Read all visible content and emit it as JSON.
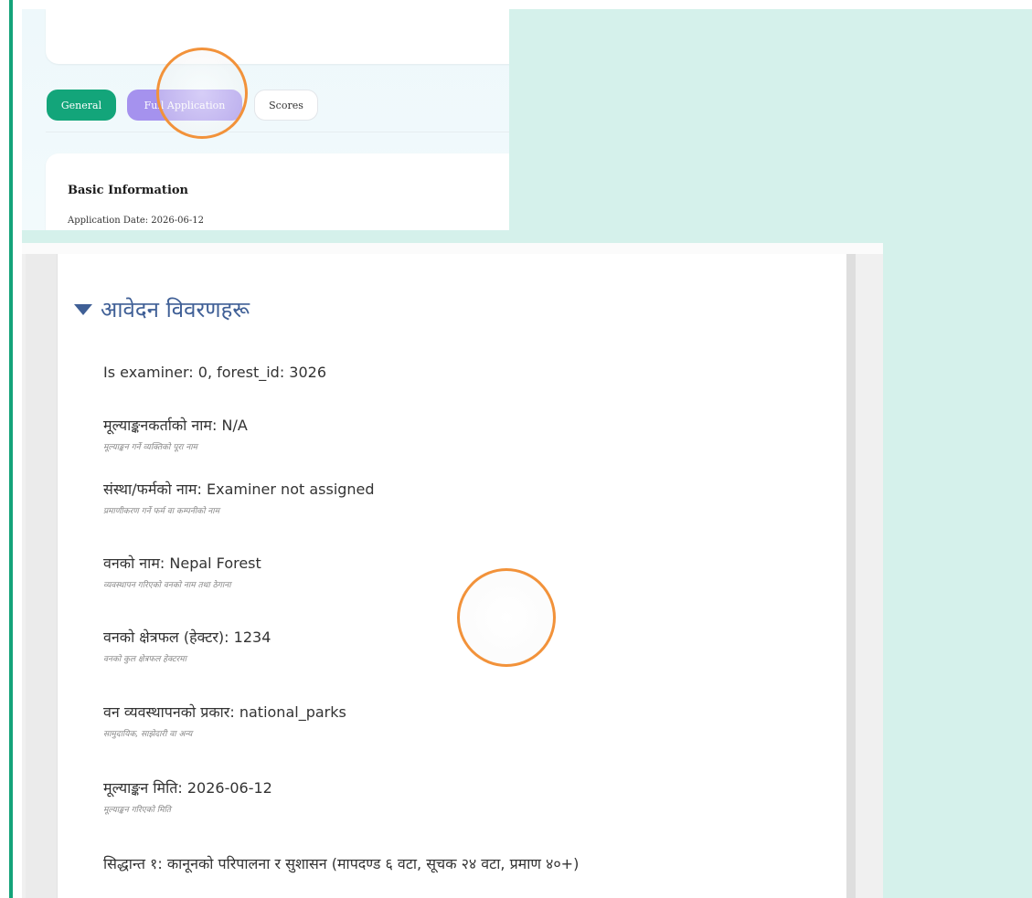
{
  "tabs": [
    {
      "label": "General"
    },
    {
      "label": "Full Application"
    },
    {
      "label": "Scores"
    }
  ],
  "basic_info": {
    "title": "Basic Information",
    "application_date": "Application Date: 2026-06-12"
  },
  "details": {
    "section_title": "आवेदन विवरणहरू",
    "debug_line": "Is examiner: 0, forest_id: 3026",
    "fields": [
      {
        "label": "मूल्याङ्कनकर्ताको नाम:",
        "value": "N/A",
        "hint": "मूल्याङ्कन गर्ने व्यक्तिको पूरा नाम"
      },
      {
        "label": "संस्था/फर्मको नाम:",
        "value": "Examiner not assigned",
        "hint": "प्रमाणीकरण गर्ने फर्म वा कम्पनीको नाम"
      },
      {
        "label": "वनको नाम:",
        "value": "Nepal Forest",
        "hint": "व्यवस्थापन गरिएको वनको नाम तथा ठेगाना"
      },
      {
        "label": "वनको क्षेत्रफल (हेक्टर):",
        "value": "1234",
        "hint": "वनको कुल क्षेत्रफल हेक्टरमा"
      },
      {
        "label": "वन व्यवस्थापनको प्रकार:",
        "value": "national_parks",
        "hint": "सामुदायिक, साझेदारी वा अन्य"
      },
      {
        "label": "मूल्याङ्कन मिति:",
        "value": "2026-06-12",
        "hint": "मूल्याङ्कन गरिएको मिति"
      }
    ],
    "principle_line": "सिद्धान्त १: कानूनको परिपालना र सुशासन (मापदण्ड ६ वटा, सूचक २४ वटा, प्रमाण ४०+)"
  },
  "colors": {
    "accent_green": "#14a37a",
    "tab_purple": "#a592ee",
    "section_blue": "#3f5f96",
    "click_ring": "#f2923a"
  }
}
